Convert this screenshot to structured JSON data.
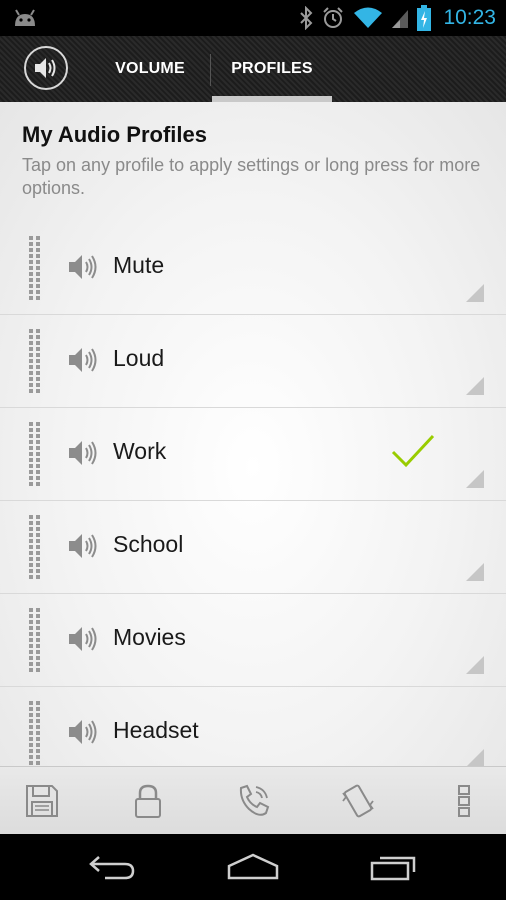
{
  "status_bar": {
    "time": "10:23",
    "icons": [
      "android-notification-icon",
      "bluetooth-icon",
      "alarm-icon",
      "wifi-icon",
      "cell-signal-icon",
      "battery-charging-icon"
    ],
    "accent_color": "#33b5e5"
  },
  "action_bar": {
    "app_icon": "speaker-icon",
    "tabs": [
      {
        "label": "VOLUME",
        "selected": false
      },
      {
        "label": "PROFILES",
        "selected": true
      }
    ]
  },
  "header": {
    "title": "My Audio Profiles",
    "subtitle": "Tap on any profile to apply settings or long press for more options."
  },
  "profiles": [
    {
      "label": "Mute",
      "icon": "speaker-icon",
      "active": false
    },
    {
      "label": "Loud",
      "icon": "speaker-icon",
      "active": false
    },
    {
      "label": "Work",
      "icon": "speaker-icon",
      "active": true
    },
    {
      "label": "School",
      "icon": "speaker-icon",
      "active": false
    },
    {
      "label": "Movies",
      "icon": "speaker-icon",
      "active": false
    },
    {
      "label": "Headset",
      "icon": "speaker-icon",
      "active": false
    }
  ],
  "check_color": "#99cc00",
  "toolbar": {
    "items": [
      "save-icon",
      "lock-icon",
      "phone-icon",
      "vibrate-icon",
      "overflow-menu-icon"
    ]
  },
  "nav_bar": {
    "items": [
      "back-icon",
      "home-icon",
      "recents-icon"
    ]
  }
}
